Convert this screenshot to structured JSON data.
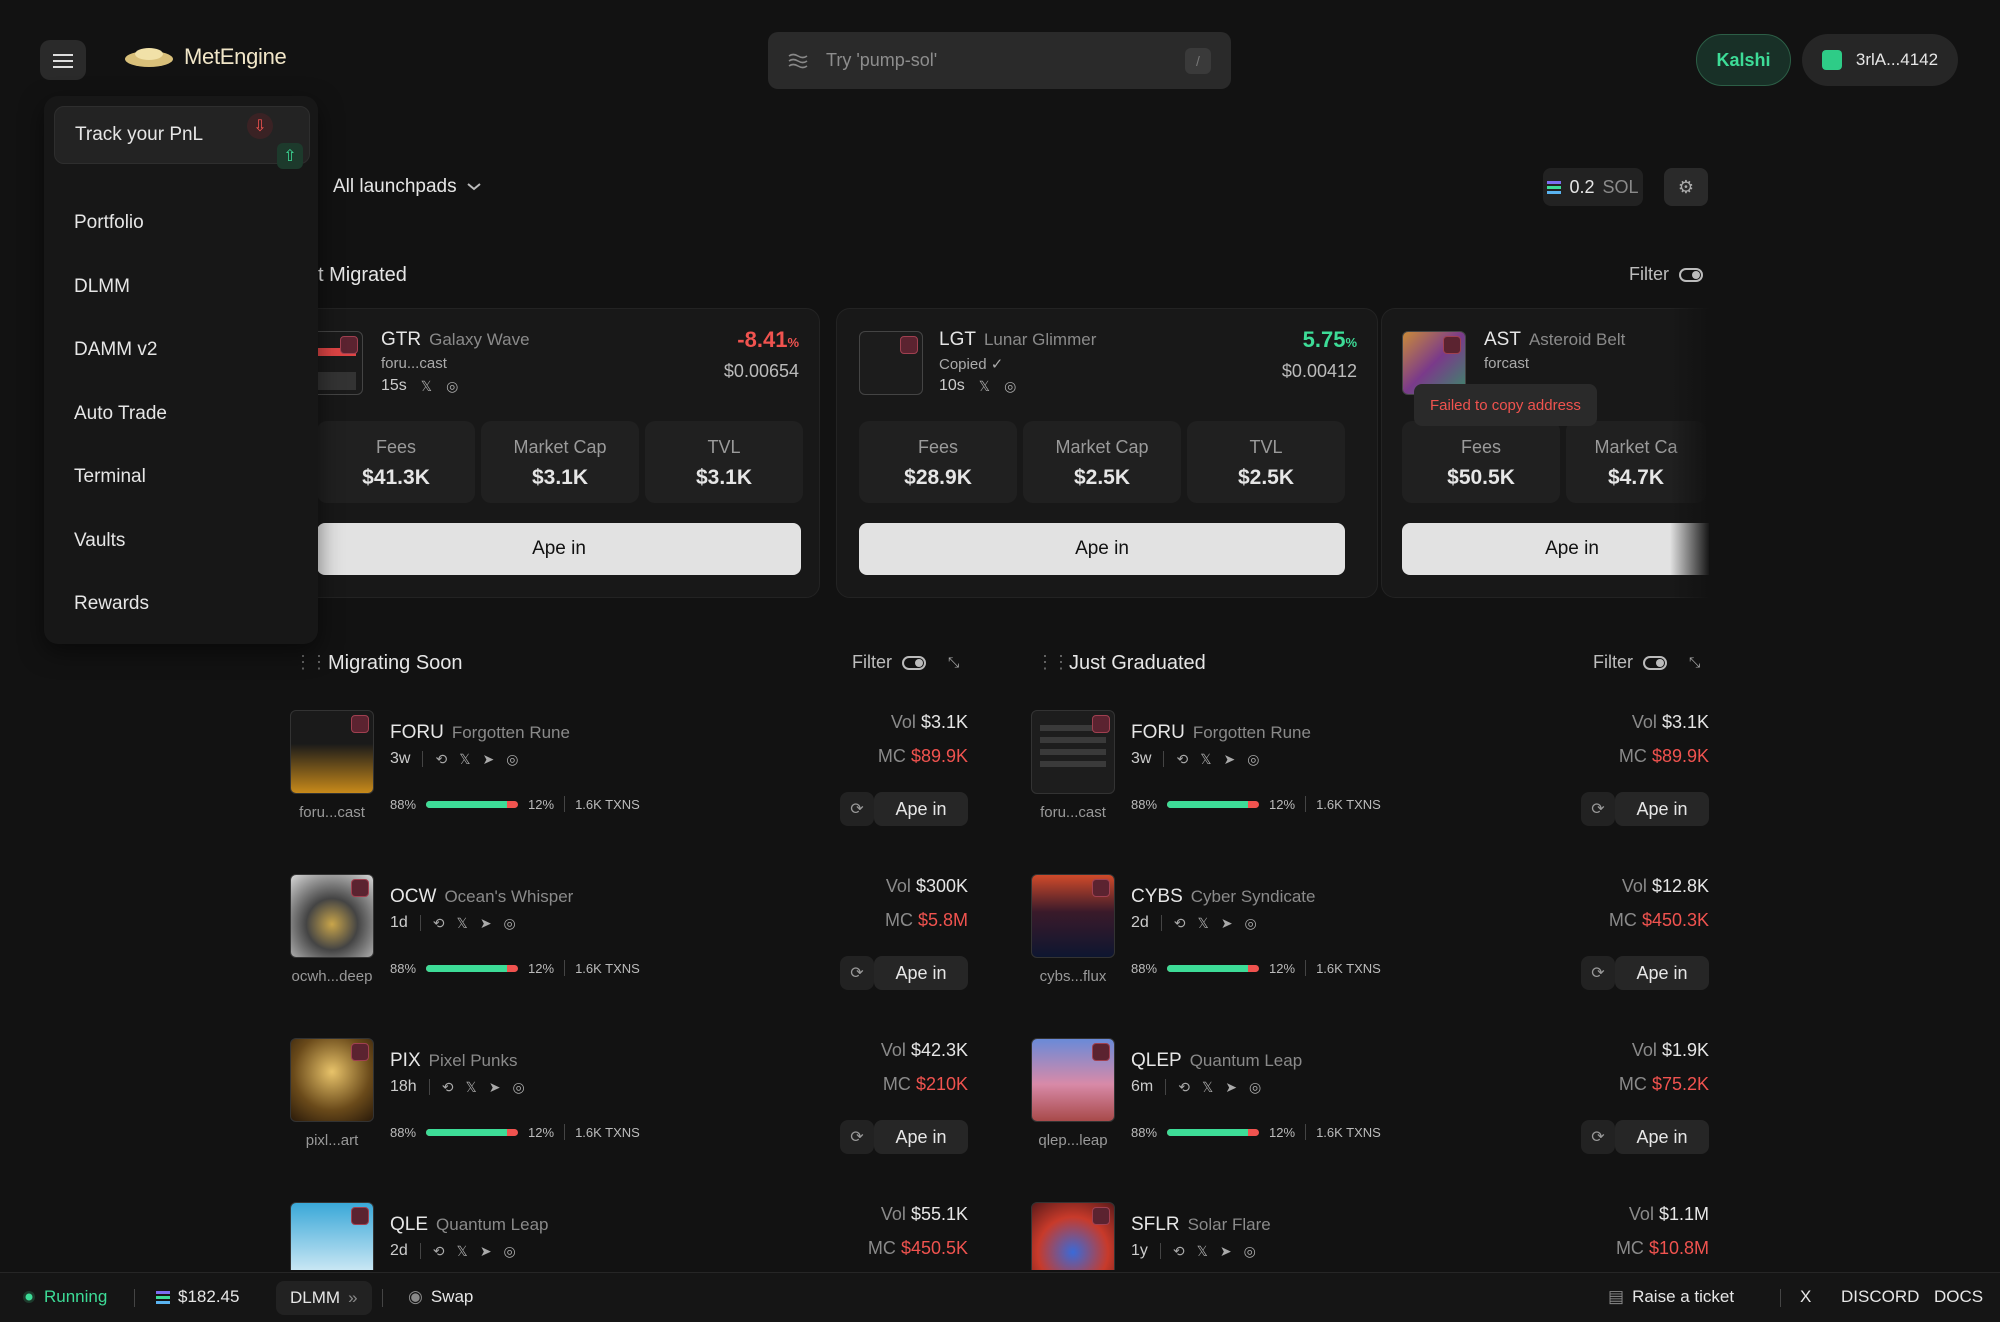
{
  "header": {
    "logo_text": "MetEngine",
    "search_placeholder": "Try 'pump-sol'",
    "search_shortcut": "/",
    "kalshi_label": "Kalshi",
    "wallet_label": "3rlA...4142"
  },
  "menu": {
    "track_pnl": "Track your PnL",
    "items": [
      "Portfolio",
      "DLMM",
      "DAMM v2",
      "Auto Trade",
      "Terminal",
      "Vaults",
      "Rewards"
    ]
  },
  "toolbar": {
    "launchpads_label": "All launchpads",
    "sol_amount": "0.2",
    "sol_unit": "SOL"
  },
  "just_migrated": {
    "title": "st Migrated",
    "filter_label": "Filter",
    "toast": "Failed to copy address",
    "cards": [
      {
        "ticker": "GTR",
        "name": "Galaxy Wave",
        "sub": "foru...cast",
        "age": "15s",
        "change": "-8.41",
        "change_unit": "%",
        "price": "$0.00654",
        "fees_label": "Fees",
        "fees": "$41.3K",
        "mc_label": "Market Cap",
        "mc": "$3.1K",
        "tvl_label": "TVL",
        "tvl": "$3.1K",
        "ape_label": "Ape in"
      },
      {
        "ticker": "LGT",
        "name": "Lunar Glimmer",
        "sub": "Copied ✓",
        "age": "10s",
        "change": "5.75",
        "change_unit": "%",
        "price": "$0.00412",
        "fees_label": "Fees",
        "fees": "$28.9K",
        "mc_label": "Market Cap",
        "mc": "$2.5K",
        "tvl_label": "TVL",
        "tvl": "$2.5K",
        "ape_label": "Ape in"
      },
      {
        "ticker": "AST",
        "name": "Asteroid Belt",
        "sub": "forcast",
        "fees_label": "Fees",
        "fees": "$50.5K",
        "mc_label": "Market Ca",
        "mc": "$4.7K",
        "ape_label": "Ape in"
      }
    ]
  },
  "migrating_soon": {
    "title": "Migrating Soon",
    "filter_label": "Filter",
    "rows": [
      {
        "ticker": "FORU",
        "name": "Forgotten Rune",
        "age": "3w",
        "handle": "foru...cast",
        "pct_left": "88%",
        "pct_right": "12%",
        "fill": 0.88,
        "txns": "1.6K TXNS",
        "vol_label": "Vol",
        "vol": "$3.1K",
        "mc_label": "MC",
        "mc": "$89.9K",
        "ape_label": "Ape in"
      },
      {
        "ticker": "OCW",
        "name": "Ocean's Whisper",
        "age": "1d",
        "handle": "ocwh...deep",
        "pct_left": "88%",
        "pct_right": "12%",
        "fill": 0.88,
        "txns": "1.6K TXNS",
        "vol_label": "Vol",
        "vol": "$300K",
        "mc_label": "MC",
        "mc": "$5.8M",
        "ape_label": "Ape in"
      },
      {
        "ticker": "PIX",
        "name": "Pixel Punks",
        "age": "18h",
        "handle": "pixl...art",
        "pct_left": "88%",
        "pct_right": "12%",
        "fill": 0.88,
        "txns": "1.6K TXNS",
        "vol_label": "Vol",
        "vol": "$42.3K",
        "mc_label": "MC",
        "mc": "$210K",
        "ape_label": "Ape in"
      },
      {
        "ticker": "QLE",
        "name": "Quantum Leap",
        "age": "2d",
        "handle": "",
        "vol_label": "Vol",
        "vol": "$55.1K",
        "mc_label": "MC",
        "mc": "$450.5K"
      }
    ]
  },
  "just_graduated": {
    "title": "Just Graduated",
    "filter_label": "Filter",
    "rows": [
      {
        "ticker": "FORU",
        "name": "Forgotten Rune",
        "age": "3w",
        "handle": "foru...cast",
        "pct_left": "88%",
        "pct_right": "12%",
        "fill": 0.88,
        "txns": "1.6K TXNS",
        "vol_label": "Vol",
        "vol": "$3.1K",
        "mc_label": "MC",
        "mc": "$89.9K",
        "ape_label": "Ape in"
      },
      {
        "ticker": "CYBS",
        "name": "Cyber Syndicate",
        "age": "2d",
        "handle": "cybs...flux",
        "pct_left": "88%",
        "pct_right": "12%",
        "fill": 0.88,
        "txns": "1.6K TXNS",
        "vol_label": "Vol",
        "vol": "$12.8K",
        "mc_label": "MC",
        "mc": "$450.3K",
        "ape_label": "Ape in"
      },
      {
        "ticker": "QLEP",
        "name": "Quantum Leap",
        "age": "6m",
        "handle": "qlep...leap",
        "pct_left": "88%",
        "pct_right": "12%",
        "fill": 0.88,
        "txns": "1.6K TXNS",
        "vol_label": "Vol",
        "vol": "$1.9K",
        "mc_label": "MC",
        "mc": "$75.2K",
        "ape_label": "Ape in"
      },
      {
        "ticker": "SFLR",
        "name": "Solar Flare",
        "age": "1y",
        "handle": "",
        "vol_label": "Vol",
        "vol": "$1.1M",
        "mc_label": "MC",
        "mc": "$10.8M"
      }
    ]
  },
  "footer": {
    "status": "Running",
    "sol_price": "$182.45",
    "dlmm_label": "DLMM",
    "swap_label": "Swap",
    "ticket_label": "Raise a ticket",
    "x_label": "X",
    "discord_label": "DISCORD",
    "docs_label": "DOCS"
  },
  "colors": {
    "accent_green": "#3ddc97",
    "accent_red": "#f0534f",
    "background": "#121212"
  }
}
